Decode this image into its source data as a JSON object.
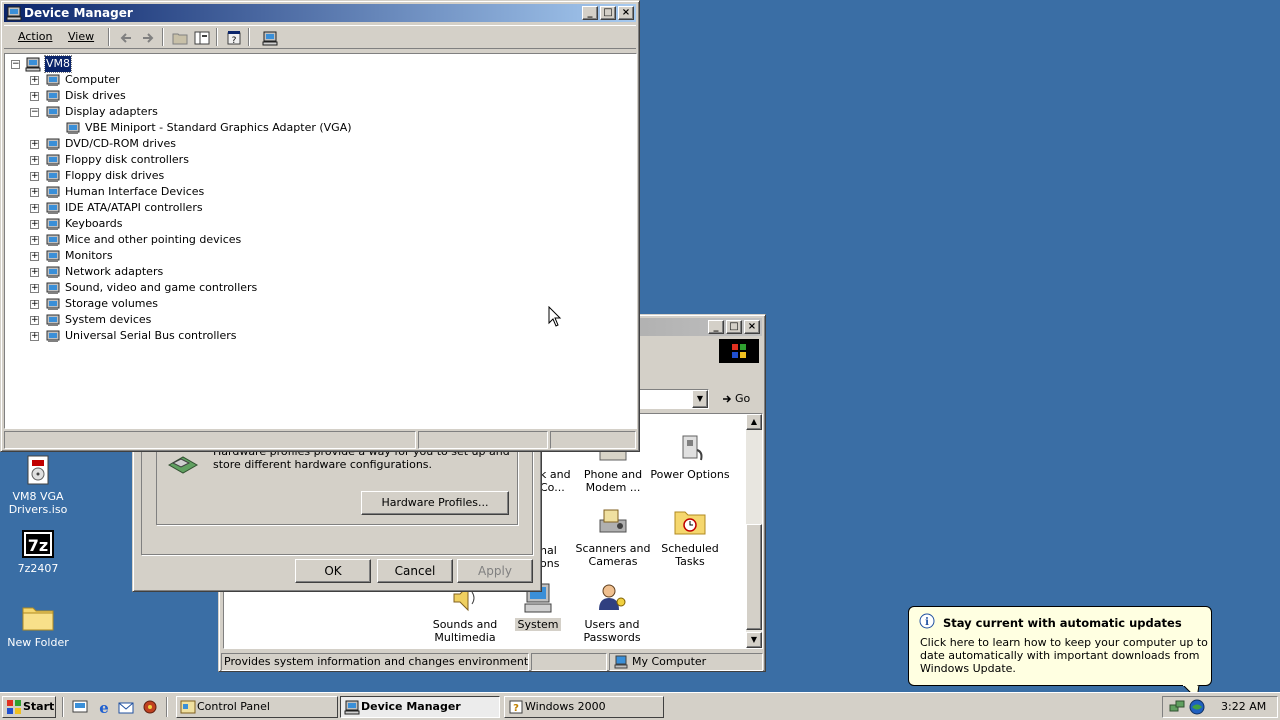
{
  "desktop": {
    "icons": [
      {
        "label": "VM8 VGA Drivers.iso",
        "icon": "iso-file-icon"
      },
      {
        "label": "7z2407",
        "icon": "7zip-icon"
      },
      {
        "label": "New Folder",
        "icon": "folder-icon"
      }
    ]
  },
  "device_manager": {
    "title": "Device Manager",
    "menu": [
      "Action",
      "View"
    ],
    "tree": {
      "root": "VM8",
      "items": [
        {
          "label": "Computer",
          "expanded": false
        },
        {
          "label": "Disk drives",
          "expanded": false
        },
        {
          "label": "Display adapters",
          "expanded": true,
          "children": [
            "VBE Miniport - Standard Graphics Adapter (VGA)"
          ]
        },
        {
          "label": "DVD/CD-ROM drives",
          "expanded": false
        },
        {
          "label": "Floppy disk controllers",
          "expanded": false
        },
        {
          "label": "Floppy disk drives",
          "expanded": false
        },
        {
          "label": "Human Interface Devices",
          "expanded": false
        },
        {
          "label": "IDE ATA/ATAPI controllers",
          "expanded": false
        },
        {
          "label": "Keyboards",
          "expanded": false
        },
        {
          "label": "Mice and other pointing devices",
          "expanded": false
        },
        {
          "label": "Monitors",
          "expanded": false
        },
        {
          "label": "Network adapters",
          "expanded": false
        },
        {
          "label": "Sound, video and game controllers",
          "expanded": false
        },
        {
          "label": "Storage volumes",
          "expanded": false
        },
        {
          "label": "System devices",
          "expanded": false
        },
        {
          "label": "Universal Serial Bus controllers",
          "expanded": false
        }
      ]
    }
  },
  "system_properties": {
    "hardware_profiles_text": "Hardware profiles provide a way for you to set up and store different hardware configurations.",
    "hardware_profiles_button": "Hardware Profiles...",
    "ok": "OK",
    "cancel": "Cancel",
    "apply": "Apply"
  },
  "control_panel": {
    "go_label": "Go",
    "items": {
      "partial_top": "k and\nCo...",
      "phone_modem": "Phone and\nModem ...",
      "power_options": "Power Options",
      "partial_mid": "nal\nons",
      "scanners_cameras": "Scanners and\nCameras",
      "scheduled_tasks": "Scheduled\nTasks",
      "sounds_multimedia": "Sounds and\nMultimedia",
      "system": "System",
      "users_passwords": "Users and\nPasswords"
    },
    "status_text": "Provides system information and changes environment settings",
    "status_location": "My Computer"
  },
  "balloon": {
    "title": "Stay current with automatic updates",
    "body": "Click here to learn how to keep your computer up to date automatically with important downloads from Windows Update."
  },
  "taskbar": {
    "start_label": "Start",
    "tasks": [
      {
        "label": "Control Panel",
        "icon": "control-panel-icon",
        "active": false
      },
      {
        "label": "Device Manager",
        "icon": "device-manager-icon",
        "active": true
      },
      {
        "label": "Windows 2000",
        "icon": "help-icon",
        "active": false
      }
    ],
    "clock": "3:22 AM"
  }
}
